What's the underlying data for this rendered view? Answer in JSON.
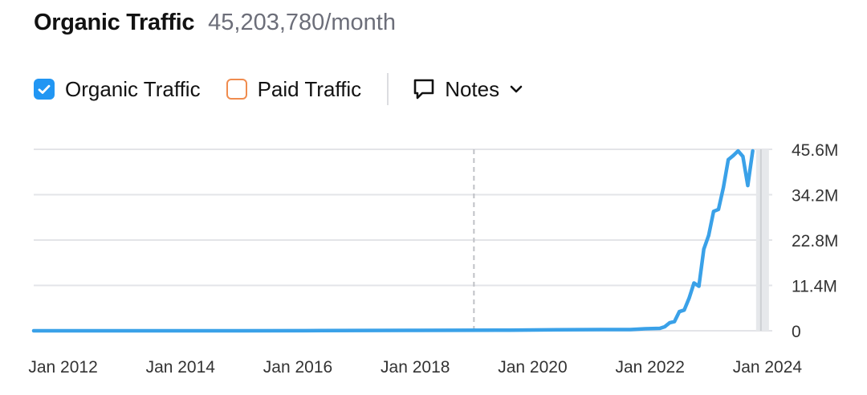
{
  "header": {
    "title": "Organic Traffic",
    "value": "45,203,780/month"
  },
  "legend": {
    "organic": {
      "label": "Organic Traffic",
      "checked": true,
      "color": "#2196f3"
    },
    "paid": {
      "label": "Paid Traffic",
      "checked": false,
      "color": "#f08c4f"
    },
    "notes": {
      "label": "Notes",
      "icon": "comment-icon",
      "dropdown_icon": "chevron-down-icon"
    }
  },
  "colors": {
    "series": "#3aa1e8",
    "grid": "#e3e4e8",
    "marker": "#bfc1c6"
  },
  "chart_data": {
    "type": "line",
    "title": "",
    "xlabel": "",
    "ylabel": "",
    "xlim": [
      "2011-07",
      "2024-02"
    ],
    "ylim": [
      0,
      45.6
    ],
    "y_unit": "M",
    "y_ticks": [
      0,
      11.4,
      22.8,
      34.2,
      45.6
    ],
    "y_tick_labels": [
      "0",
      "11.4M",
      "22.8M",
      "34.2M",
      "45.6M"
    ],
    "x_ticks": [
      "2012-01",
      "2014-01",
      "2016-01",
      "2018-01",
      "2020-01",
      "2022-01",
      "2024-01"
    ],
    "x_tick_labels": [
      "Jan 2012",
      "Jan 2014",
      "Jan 2016",
      "Jan 2018",
      "Jan 2020",
      "Jan 2022",
      "Jan 2024"
    ],
    "grid": true,
    "annotation_line_date": "2019-01",
    "highlighted_period": "2023-12",
    "series": [
      {
        "name": "Organic Traffic",
        "points": [
          [
            "2011-07",
            0.0
          ],
          [
            "2013-01",
            0.0
          ],
          [
            "2015-01",
            0.0
          ],
          [
            "2016-06",
            0.05
          ],
          [
            "2018-01",
            0.1
          ],
          [
            "2019-06",
            0.15
          ],
          [
            "2020-06",
            0.25
          ],
          [
            "2021-03",
            0.3
          ],
          [
            "2021-09",
            0.3
          ],
          [
            "2021-12",
            0.5
          ],
          [
            "2022-03",
            0.6
          ],
          [
            "2022-04",
            1.0
          ],
          [
            "2022-05",
            2.0
          ],
          [
            "2022-06",
            2.3
          ],
          [
            "2022-07",
            4.8
          ],
          [
            "2022-08",
            5.2
          ],
          [
            "2022-09",
            8.2
          ],
          [
            "2022-10",
            12.0
          ],
          [
            "2022-11",
            11.2
          ],
          [
            "2022-12",
            20.5
          ],
          [
            "2023-01",
            24.0
          ],
          [
            "2023-02",
            30.0
          ],
          [
            "2023-03",
            30.5
          ],
          [
            "2023-04",
            36.0
          ],
          [
            "2023-05",
            43.0
          ],
          [
            "2023-06",
            44.0
          ],
          [
            "2023-07",
            45.2
          ],
          [
            "2023-08",
            43.8
          ],
          [
            "2023-09",
            36.5
          ],
          [
            "2023-10",
            45.2
          ]
        ]
      }
    ]
  }
}
